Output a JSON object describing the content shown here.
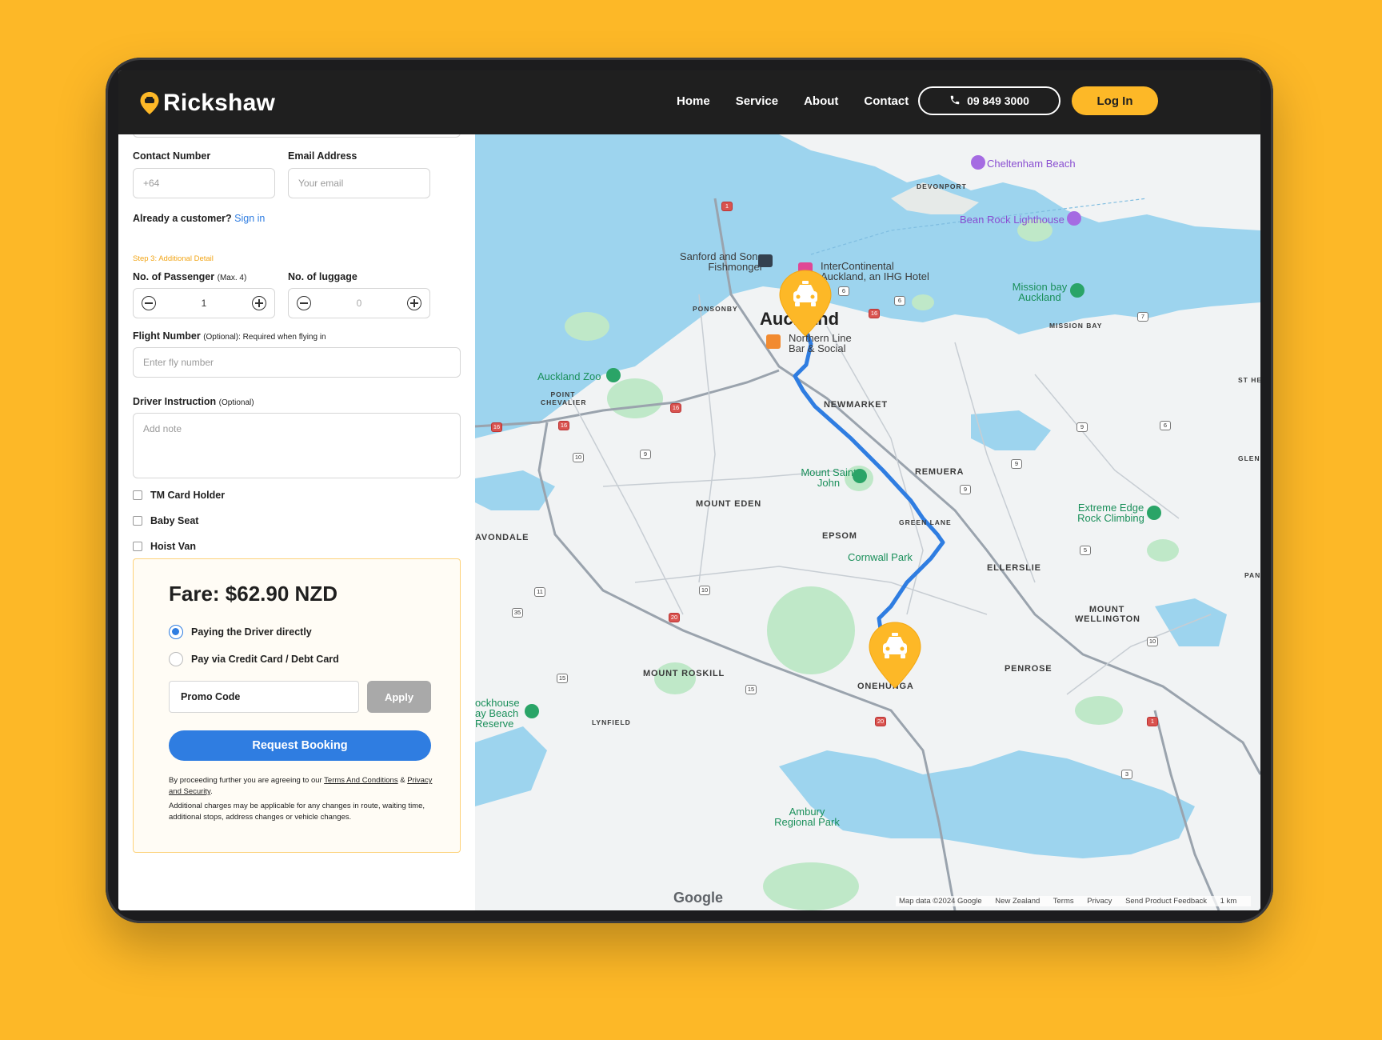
{
  "nav": {
    "brand": "Rickshaw",
    "links": [
      "Home",
      "Service",
      "About",
      "Contact"
    ],
    "phone": "09 849 3000",
    "login": "Log In"
  },
  "form": {
    "contact_label": "Contact Number",
    "contact_placeholder": "+64",
    "email_label": "Email Address",
    "email_placeholder": "Your email",
    "already_text": "Already a customer?",
    "sign_in": "Sign in",
    "step3": "Step 3: Additional Detail",
    "passenger_label": "No. of Passenger",
    "passenger_hint": "(Max. 4)",
    "passenger_value": "1",
    "luggage_label": "No. of luggage",
    "luggage_value": "0",
    "flight_label": "Flight Number",
    "flight_hint": "(Optional): Required when flying in",
    "flight_placeholder": "Enter fly number",
    "driver_label": "Driver Instruction",
    "driver_hint": "(Optional)",
    "driver_placeholder": "Add note",
    "checkboxes": [
      "TM Card Holder",
      "Baby Seat",
      "Hoist Van"
    ]
  },
  "fare": {
    "title": "Fare: $62.90 NZD",
    "option1": "Paying the Driver directly",
    "option2": "Pay via Credit Card / Debt Card",
    "promo_placeholder": "Promo Code",
    "apply": "Apply",
    "request": "Request Booking",
    "legal1_a": "By proceeding further you are agreeing to our ",
    "legal1_terms": "Terms And Conditions",
    "legal1_and": " & ",
    "legal1_privacy": "Privacy and Security",
    "legal1_end": ".",
    "legal2": "Additional charges may be applicable for any changes in route, waiting time, additional stops, address changes or vehicle changes."
  },
  "map": {
    "city": "Auckland",
    "areas": [
      "DEVONPORT",
      "PONSONBY",
      "NEWMARKET",
      "REMUERA",
      "MOUNT EDEN",
      "EPSOM",
      "AVONDALE",
      "ELLERSLIE",
      "MOUNT WELLINGTON",
      "MOUNT ROSKILL",
      "ONEHUNGA",
      "PENROSE",
      "MISSION BAY",
      "POINT CHEVALIER",
      "LYNFIELD",
      "GREEN LANE",
      "ST HELI",
      "GLEN IN",
      "PANM"
    ],
    "pois": {
      "cheltenham": "Cheltenham Beach",
      "bean_rock": "Bean Rock Lighthouse",
      "sanford": "Sanford and Sons Fishmonger",
      "intercontinental": "InterContinental Auckland, an IHG Hotel",
      "mission_bay": "Mission bay Auckland",
      "northern_line": "Northern Line Bar & Social",
      "zoo": "Auckland Zoo",
      "mt_john": "Mount Saint John",
      "cornwall": "Cornwall Park",
      "extreme_edge": "Extreme Edge Rock Climbing",
      "lighthouse_beach": "ockhouse ay Beach Reserve",
      "ambury": "Ambury Regional Park"
    },
    "google": "Google",
    "attribution": [
      "Map data ©2024 Google",
      "New Zealand",
      "Terms",
      "Privacy",
      "Send Product Feedback",
      "1 km"
    ]
  },
  "colors": {
    "brand_yellow": "#FDB827",
    "nav_bg": "#1f1f1f",
    "accent_blue": "#2f7de1",
    "water": "#9dd4ee",
    "park": "#bfe8c8"
  }
}
